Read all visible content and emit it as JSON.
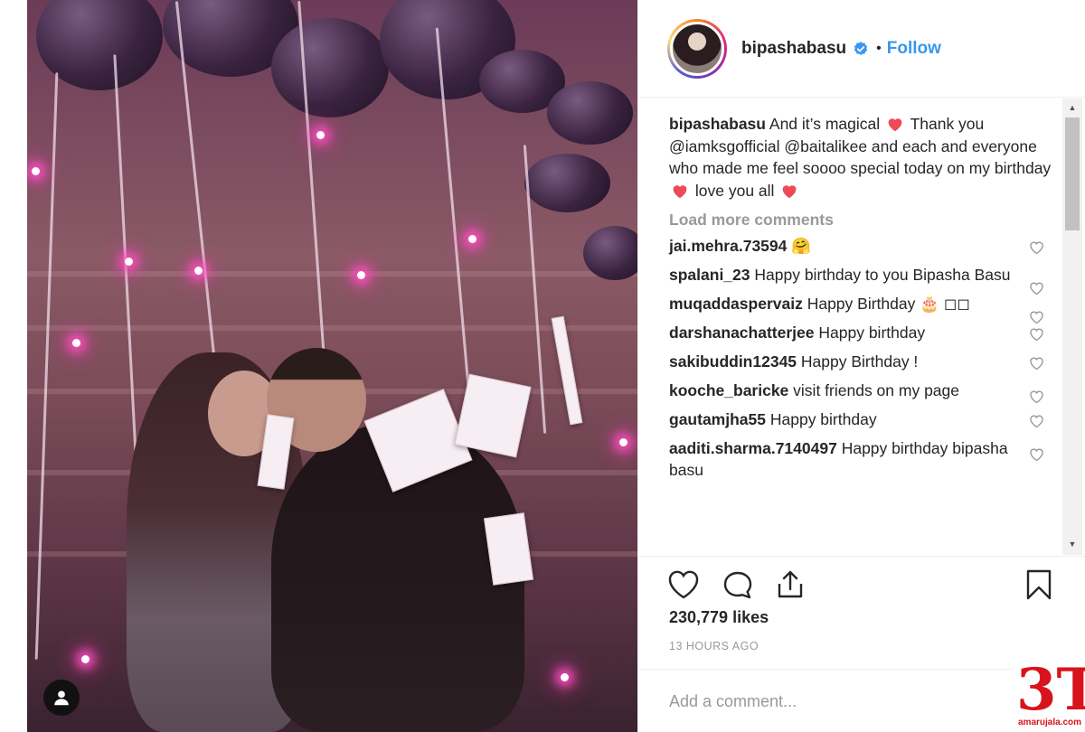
{
  "post": {
    "username": "bipashabasu",
    "follow_label": "Follow",
    "caption": {
      "username": "bipashabasu",
      "part1": "And it’s magical",
      "part2": "Thank you @iamksgofficial @baitalikee and each and everyone who made me feel soooo special today on my birthday",
      "part3": "love you all"
    },
    "load_more": "Load more comments",
    "comments": [
      {
        "user": "jai.mehra.73594",
        "text": "🤗"
      },
      {
        "user": "spalani_23",
        "text": "Happy birthday to you Bipasha Basu"
      },
      {
        "user": "muqaddaspervaiz",
        "text": "Happy Birthday 🎂 ◻◻"
      },
      {
        "user": "darshanachatterjee",
        "text": "Happy birthday"
      },
      {
        "user": "sakibuddin12345",
        "text": "Happy Birthday !"
      },
      {
        "user": "kooche_baricke",
        "text": "visit friends on my page"
      },
      {
        "user": "gautamjha55",
        "text": "Happy birthday"
      },
      {
        "user": "aaditi.sharma.7140497",
        "text": "Happy birthday bipasha basu"
      }
    ],
    "likes": "230,779 likes",
    "time": "13 HOURS AGO",
    "add_comment_placeholder": "Add a comment..."
  },
  "watermark": {
    "glyph": "3T",
    "site": "amarujala.com"
  },
  "icons": [
    "user-icon",
    "verified-icon",
    "heart-icon",
    "comment-icon",
    "share-icon",
    "bookmark-icon"
  ],
  "colors": {
    "follow": "#3897f0",
    "red_heart": "#ed4956",
    "muted": "#999999",
    "watermark": "#d7141c"
  }
}
